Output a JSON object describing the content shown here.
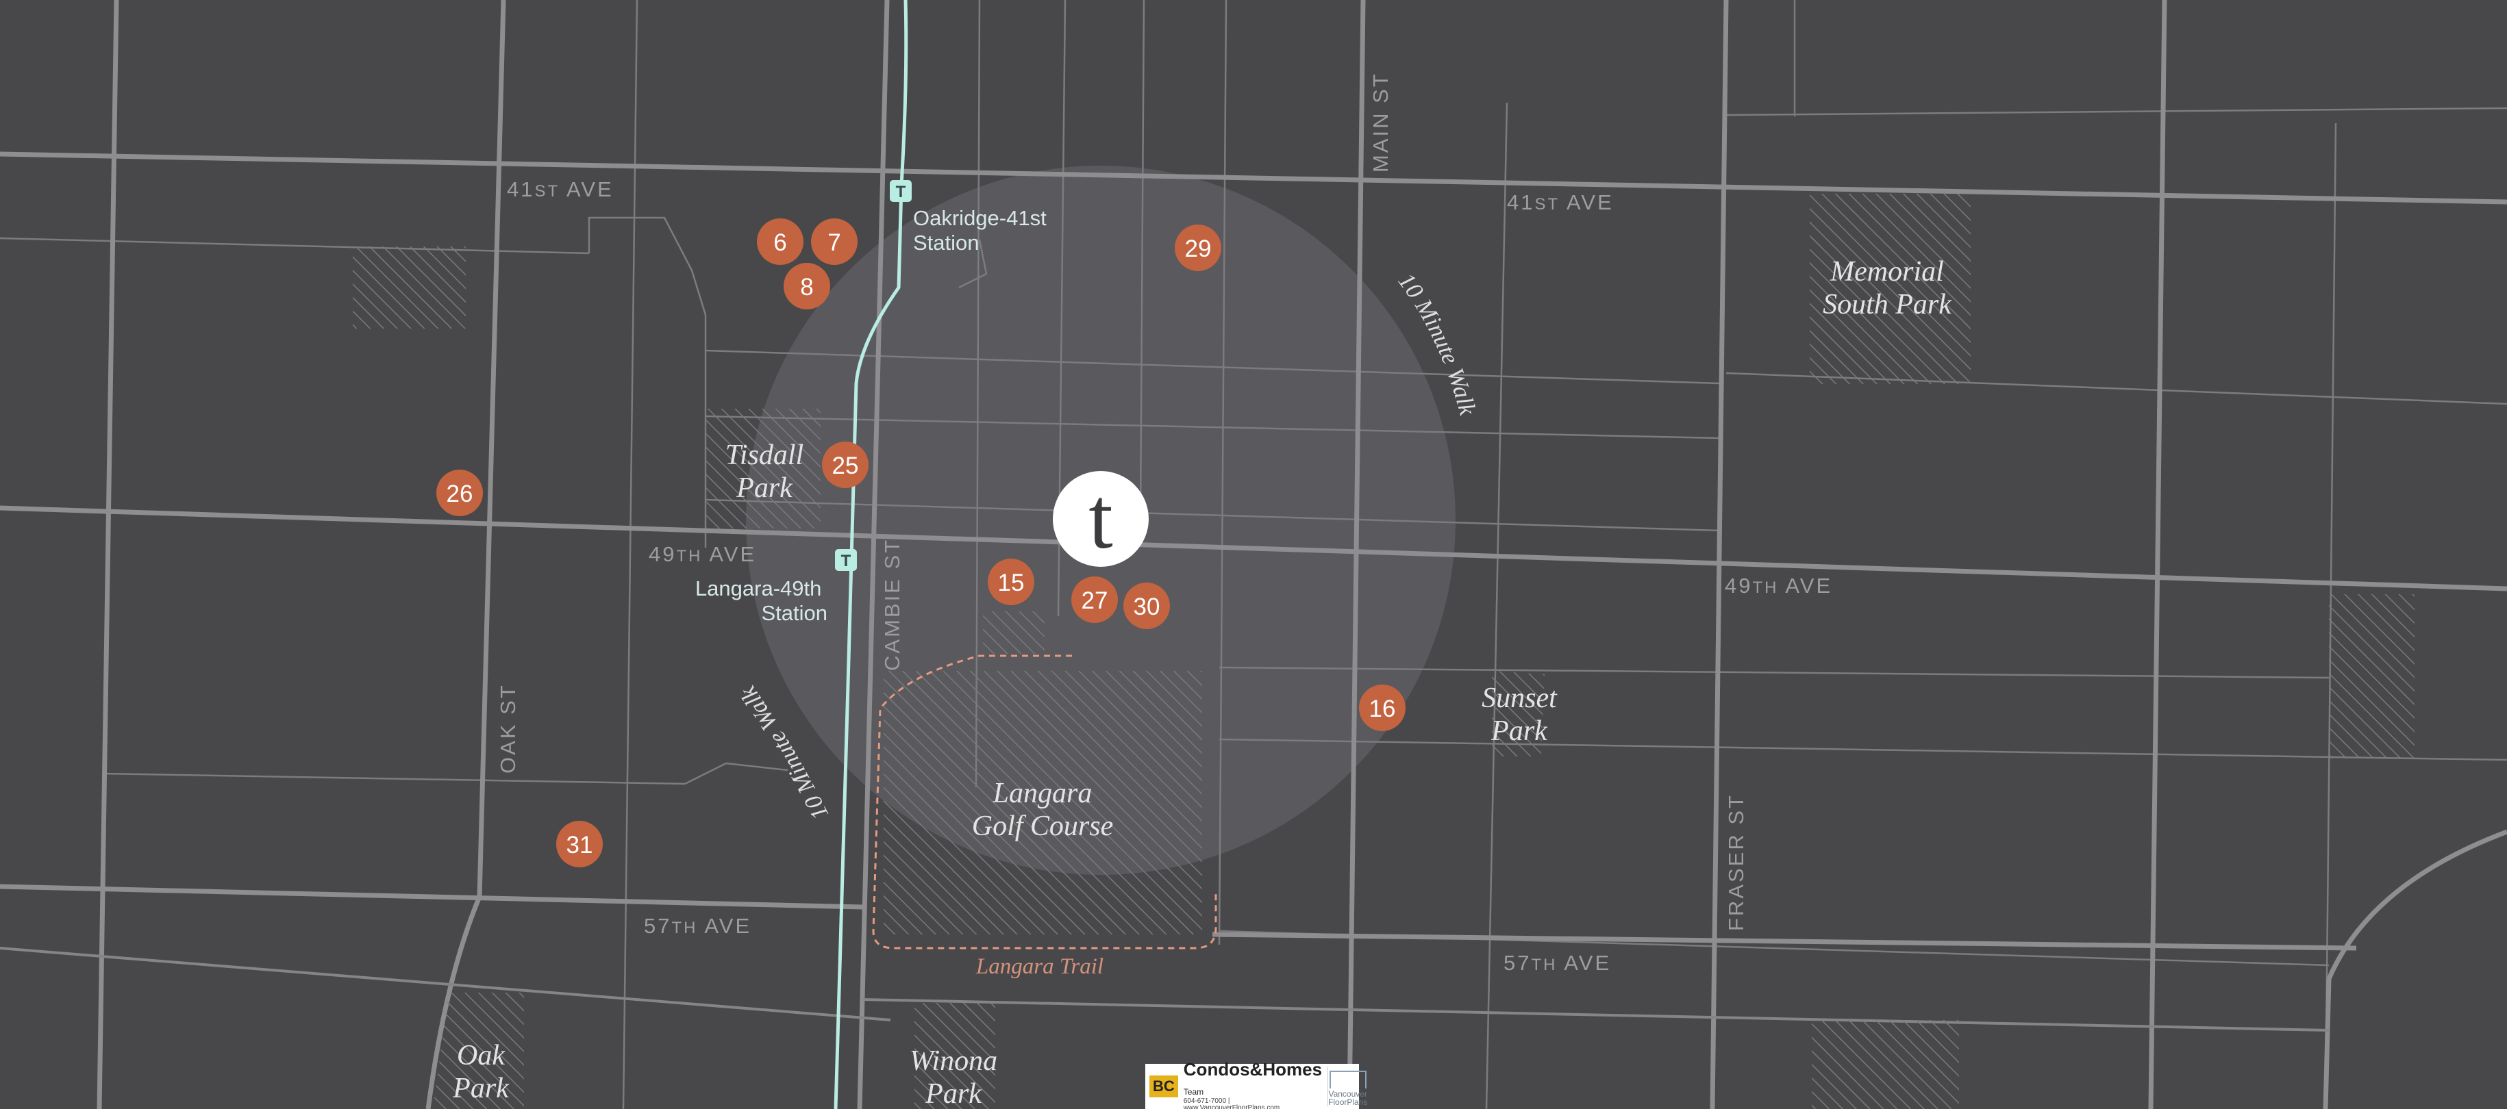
{
  "streets": {
    "ave41_west": [
      "41",
      "ST",
      " AVE"
    ],
    "ave41_east": [
      "41",
      "ST",
      " AVE"
    ],
    "ave49_west": [
      "49",
      "TH",
      " AVE"
    ],
    "ave49_east": [
      "49",
      "TH",
      " AVE"
    ],
    "ave57_west": [
      "57",
      "TH",
      " AVE"
    ],
    "ave57_east": [
      "57",
      "TH",
      " AVE"
    ],
    "main": "MAIN ST",
    "cambie": "CAMBIE ST",
    "oak": "OAK ST",
    "fraser": "FRASER ST"
  },
  "parks": {
    "tisdall": [
      "Tisdall",
      "Park"
    ],
    "memorial": [
      "Memorial",
      "South Park"
    ],
    "sunset": [
      "Sunset",
      "Park"
    ],
    "langara": [
      "Langara",
      "Golf Course"
    ],
    "oak": [
      "Oak",
      "Park"
    ],
    "winona": [
      "Winona",
      "Park"
    ]
  },
  "stations": {
    "oakridge": [
      "Oakridge-41st",
      "Station"
    ],
    "langara": [
      "Langara-49th",
      "Station"
    ]
  },
  "transit_icon_label": "T",
  "walk_label": "10 Minute Walk",
  "trail_label": "Langara Trail",
  "center_logo": "t",
  "pois": [
    "6",
    "7",
    "8",
    "29",
    "25",
    "26",
    "15",
    "27",
    "30",
    "16",
    "31"
  ],
  "badge": {
    "bc": "BC",
    "main": "Condos",
    "amp": "&",
    "homes": "Homes",
    "team": "Team",
    "contact": "604-671-7000 | www.VancouverFloorPlans.com",
    "vfp_top": "Vancouver",
    "vfp_bottom": "FloorPlans"
  },
  "colors": {
    "background": "#48484b",
    "road": "#8e8e90",
    "transit_line": "#b9ece2",
    "poi": "#c4633f",
    "trail": "#e39a80",
    "walk_circle": "#5e5e62"
  }
}
